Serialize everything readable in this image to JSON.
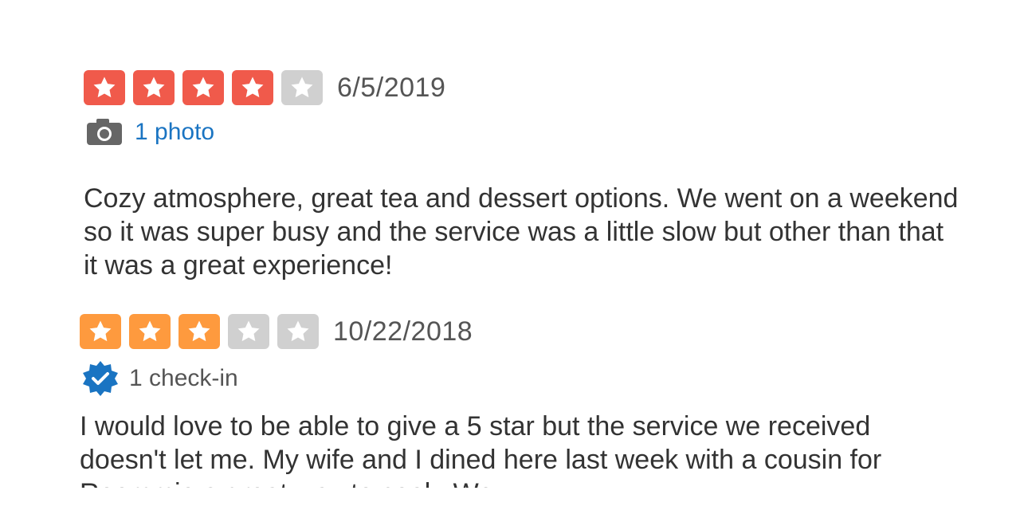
{
  "colors": {
    "star_red": "#f05a4b",
    "star_orange": "#fe9a3e",
    "star_empty": "#d0d0d0",
    "link_blue": "#1a74c2",
    "checkin_blue": "#1a74c2",
    "camera_gray": "#666666"
  },
  "reviews": [
    {
      "rating": 4,
      "max_rating": 5,
      "star_color": "#f05a4b",
      "date": "6/5/2019",
      "meta_icon": "camera-icon",
      "meta_text": "1 photo",
      "text": "Cozy atmosphere, great tea and dessert options. We went on a weekend so it was super busy and the service was a little slow but other than that it was a great experience!"
    },
    {
      "rating": 3,
      "max_rating": 5,
      "star_color": "#fe9a3e",
      "date": "10/22/2018",
      "meta_icon": "check-in-badge-icon",
      "meta_text": "1 check-in",
      "text": "I would love to be able to give a 5 star but the service we received doesn't let me. My wife and I dined here last week with a cousin for Roommie a great way to cook. We"
    }
  ]
}
